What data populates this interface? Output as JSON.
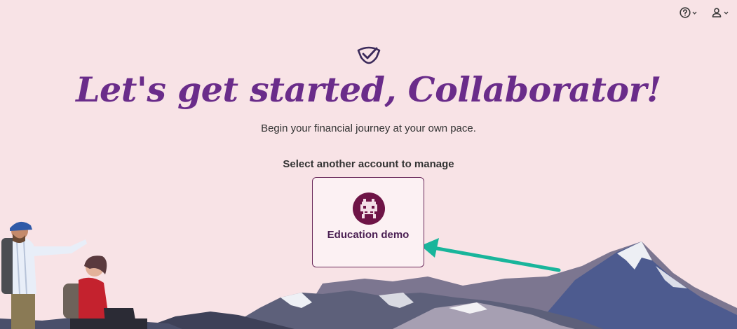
{
  "header": {
    "help_icon": "help-circle-icon",
    "account_icon": "user-icon"
  },
  "brand": {
    "logo_icon": "shield-check-logo",
    "color": "#6a2c8a"
  },
  "main": {
    "title": "Let's get started, Collaborator!",
    "subtitle": "Begin your financial journey at your own pace.",
    "section_label": "Select another account to manage"
  },
  "accounts": [
    {
      "label": "Education demo",
      "avatar_icon": "pixel-robot-avatar",
      "avatar_color": "#6e1446"
    }
  ],
  "colors": {
    "background": "#f8e3e6",
    "card_border": "#6b2a5b",
    "annotation_arrow": "#19b59b"
  }
}
